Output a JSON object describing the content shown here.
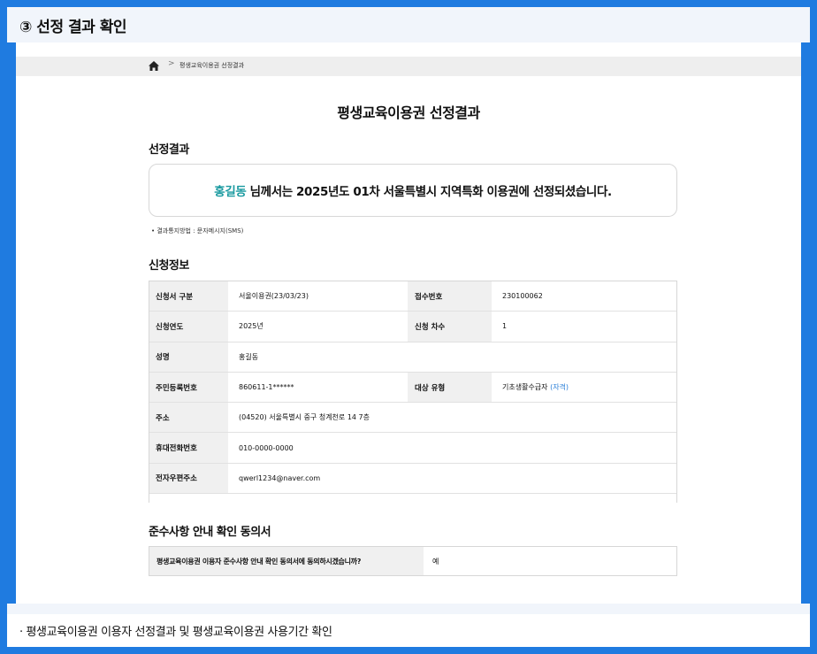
{
  "header": {
    "title": "③ 선정 결과 확인"
  },
  "breadcrumb": {
    "separator": ">",
    "current": "평생교육이용권 선정결과"
  },
  "page_title": "평생교육이용권 선정결과",
  "result_section": {
    "title": "선정결과",
    "name": "홍길동",
    "message": " 님께서는 2025년도 01차 서울특별시 지역특화 이용권에 선정되셨습니다.",
    "notice": "• 결과통지방법 : 문자메시지(SMS)"
  },
  "application_section": {
    "title": "신청정보",
    "rows": [
      {
        "label1": "신청서 구분",
        "value1": "서울이용권(23/03/23)",
        "label2": "접수번호",
        "value2": "230100062"
      },
      {
        "label1": "신청연도",
        "value1": "2025년",
        "label2": "신청 차수",
        "value2": "1"
      },
      {
        "label1": "성명",
        "value1": "홍길동"
      },
      {
        "label1": "주민등록번호",
        "value1": "860611-1******",
        "label2": "대상 유형",
        "value2": "기초생활수급자",
        "value2_extra": "(자격)"
      },
      {
        "label1": "주소",
        "value1": "(04520) 서울특별시 중구 청계천로 14 7층"
      },
      {
        "label1": "휴대전화번호",
        "value1": "010-0000-0000"
      },
      {
        "label1": "전자우편주소",
        "value1": "qwerl1234@naver.com"
      }
    ]
  },
  "consent_section": {
    "title": "준수사항 안내 확인 동의서",
    "question": "평생교육이용권 이용자 준수사항 안내 확인 동의서에 동의하시겠습니까?",
    "answer": "예"
  },
  "footer": {
    "text": "· 평생교육이용권 이용자 선정결과 및 평생교육이용권 사용기간 확인"
  },
  "colors": {
    "frame": "#1f7be0",
    "name_highlight": "#1a9aa0",
    "link": "#2a7fd8"
  }
}
